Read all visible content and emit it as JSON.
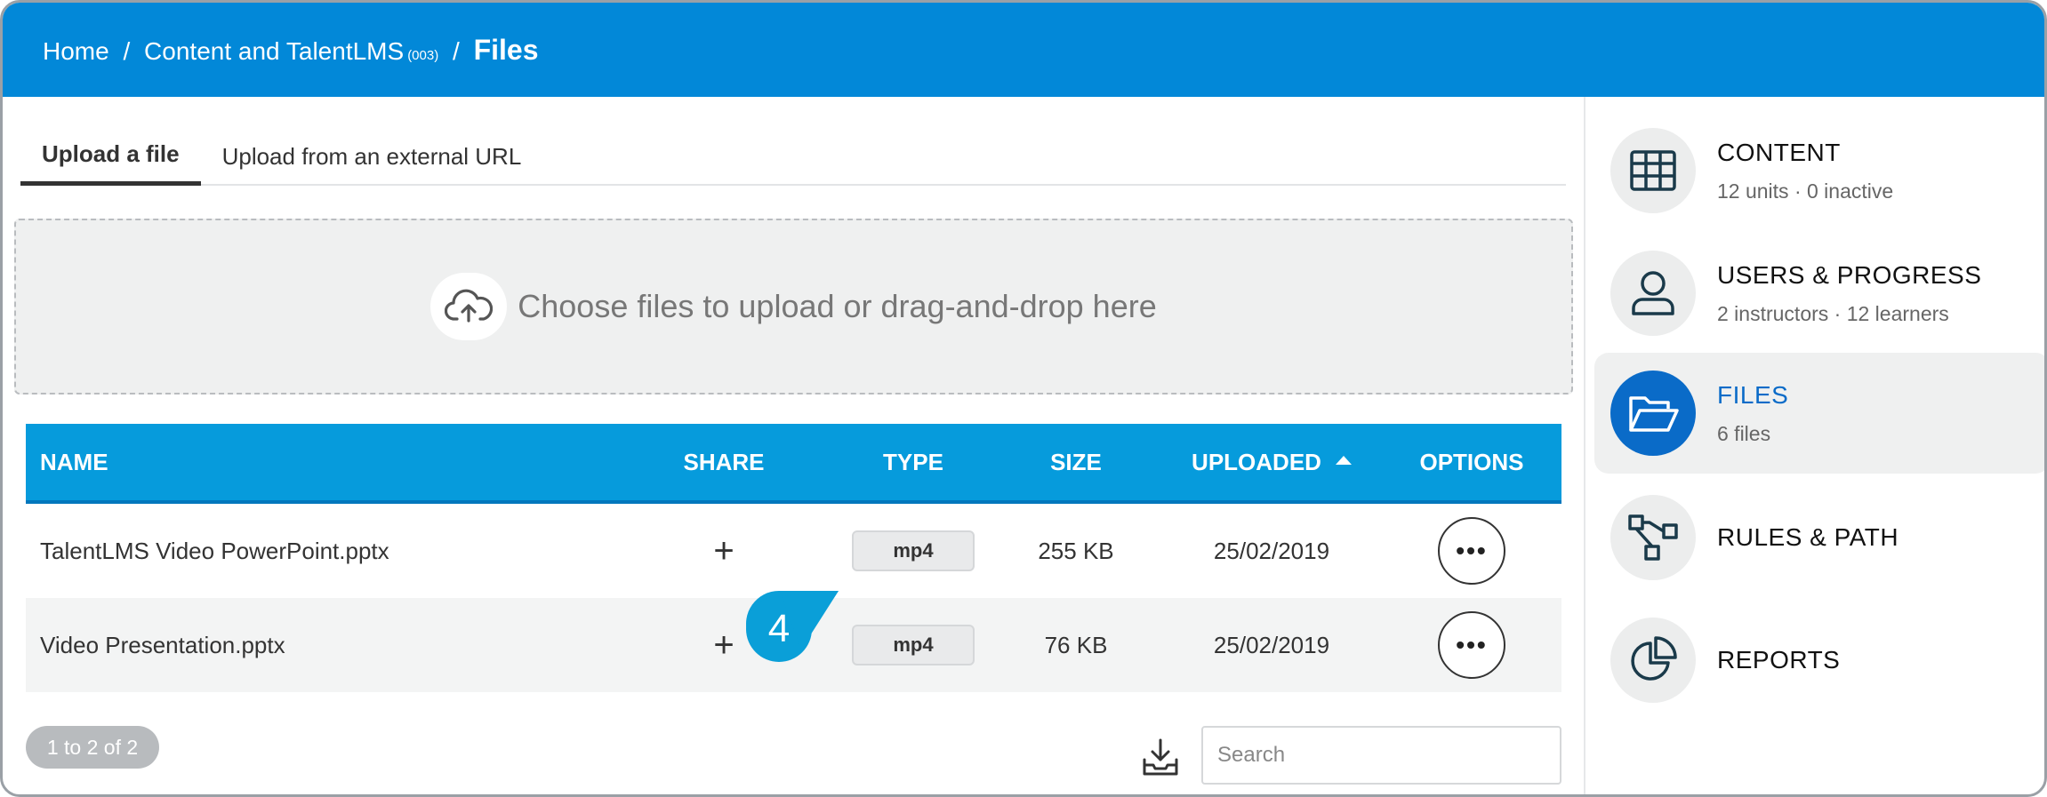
{
  "breadcrumb": {
    "home": "Home",
    "sep1": "/",
    "course": "Content and TalentLMS",
    "course_code": "(003)",
    "sep2": "/",
    "current": "Files"
  },
  "tabs": [
    {
      "label": "Upload a file",
      "active": true
    },
    {
      "label": "Upload from an external URL",
      "active": false
    }
  ],
  "upload": {
    "icon": "cloud-upload-icon",
    "text": "Choose files to upload or drag-and-drop here"
  },
  "table": {
    "columns": {
      "name": "NAME",
      "share": "SHARE",
      "type": "TYPE",
      "size": "SIZE",
      "uploaded": "UPLOADED",
      "options": "OPTIONS"
    },
    "sort": {
      "column": "uploaded",
      "direction": "ascending"
    },
    "rows": [
      {
        "name": "TalentLMS Video PowerPoint.pptx",
        "share": "+",
        "type": "mp4",
        "size": "255 KB",
        "uploaded": "25/02/2019",
        "options": "•••"
      },
      {
        "name": "Video Presentation.pptx",
        "share": "+",
        "type": "mp4",
        "size": "76 KB",
        "uploaded": "25/02/2019",
        "options": "•••"
      }
    ]
  },
  "footer": {
    "pager": "1 to 2 of 2",
    "export_icon": "download-tray-icon",
    "search_placeholder": "Search"
  },
  "callout": {
    "number": "4",
    "color": "#0a9fd8"
  },
  "sidebar": {
    "items": [
      {
        "title": "CONTENT",
        "subtitle": "12 units · 0 inactive",
        "icon": "grid-icon",
        "active": false
      },
      {
        "title": "USERS & PROGRESS",
        "subtitle": "2 instructors · 12 learners",
        "icon": "user-icon",
        "active": false
      },
      {
        "title": "FILES",
        "subtitle": "6 files",
        "icon": "folder-open-icon",
        "active": true
      },
      {
        "title": "RULES & PATH",
        "subtitle": "",
        "icon": "flow-icon",
        "active": false
      },
      {
        "title": "REPORTS",
        "subtitle": "",
        "icon": "pie-chart-icon",
        "active": false
      }
    ]
  },
  "colors": {
    "header_bg": "#0288d8",
    "table_header_bg": "#069bdc",
    "active_accent": "#0a6bc8",
    "callout": "#0a9fd8"
  }
}
